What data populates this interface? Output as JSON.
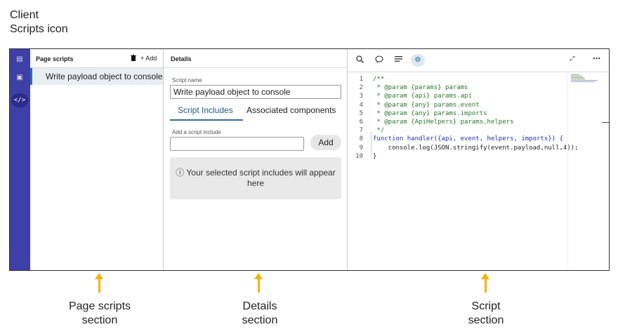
{
  "annotations": {
    "client_scripts_icon": "Client Scripts icon",
    "page_scripts_section": "Page scripts section",
    "details_section": "Details section",
    "script_section": "Script section"
  },
  "colors": {
    "rail": "#3f3fa8",
    "accent": "#2a6ea8",
    "arrow": "#f5b400",
    "comment": "#2a7a2a",
    "keyword": "#1f2fb0"
  },
  "rail": {
    "icons": [
      "list-icon",
      "layout-icon",
      "code-icon"
    ],
    "active_glyph": "</>"
  },
  "page_scripts": {
    "title": "Page scripts",
    "add_label": "+ Add",
    "items": [
      {
        "label": "Write payload object to console",
        "selected": true
      }
    ]
  },
  "details": {
    "title": "Details",
    "script_name_label": "Script name",
    "script_name_value": "Write payload object to console",
    "tabs": [
      {
        "label": "Script Includes",
        "active": true
      },
      {
        "label": "Associated components",
        "active": false
      }
    ],
    "add_include_label": "Add a script include",
    "add_include_value": "",
    "add_button": "Add",
    "empty_message": "ⓘ Your selected script includes will appear here"
  },
  "script": {
    "toolbar_icons": [
      "search-icon",
      "comment-icon",
      "format-icon",
      "script-settings-icon",
      "expand-icon",
      "more-icon"
    ],
    "line_numbers": [
      "1",
      "2",
      "3",
      "4",
      "5",
      "6",
      "7",
      "8",
      "9",
      "10"
    ],
    "lines": [
      "/**",
      " * @param {params} params",
      " * @param {api} params.api",
      " * @param {any} params.event",
      " * @param {any} params.imports",
      " * @param {ApiHelpers} params.helpers",
      " */",
      "function handler({api, event, helpers, imports}) {",
      "    console.log(JSON.stringify(event.payload,null,4));",
      "}"
    ]
  }
}
